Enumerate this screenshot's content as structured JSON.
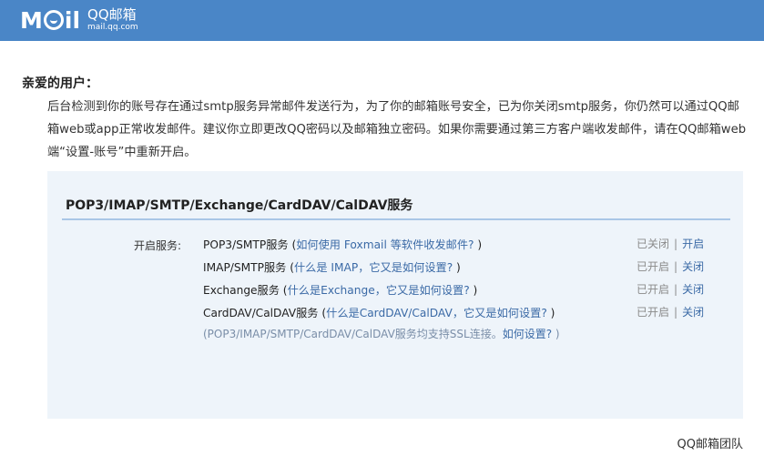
{
  "header": {
    "logo_word_left": "M",
    "logo_word_right": "il",
    "brand": "QQ邮箱",
    "domain": "mail.qq.com",
    "bar_color": "#4a86c7"
  },
  "greeting": "亲爱的用户：",
  "message": "后台检测到你的账号存在通过smtp服务异常邮件发送行为，为了你的邮箱账号安全，已为你关闭smtp服务，你仍然可以通过QQ邮箱web或app正常收发邮件。建议你立即更改QQ密码以及邮箱独立密码。如果你需要通过第三方客户端收发邮件，请在QQ邮箱web端“设置-账号”中重新开启。",
  "panel": {
    "title": "POP3/IMAP/SMTP/Exchange/CardDAV/CalDAV服务",
    "services_label": "开启服务:",
    "services": [
      {
        "name": "POP3/SMTP服务",
        "open_paren": " (",
        "help": "如何使用 Foxmail 等软件收发邮件?",
        "close_paren": " )",
        "status": "已关闭",
        "divider": "|",
        "action": "开启"
      },
      {
        "name": "IMAP/SMTP服务",
        "open_paren": " (",
        "help": "什么是 IMAP，它又是如何设置?",
        "close_paren": " )",
        "status": "已开启",
        "divider": "|",
        "action": "关闭"
      },
      {
        "name": "Exchange服务",
        "open_paren": " (",
        "help": "什么是Exchange，它又是如何设置?",
        "close_paren": " )",
        "status": "已开启",
        "divider": "|",
        "action": "关闭"
      },
      {
        "name": "CardDAV/CalDAV服务",
        "open_paren": " (",
        "help": "什么是CardDAV/CalDAV，它又是如何设置?",
        "close_paren": " )",
        "status": "已开启",
        "divider": "|",
        "action": "关闭"
      }
    ],
    "note_text": "(POP3/IMAP/SMTP/CardDAV/CalDAV服务均支持SSL连接。",
    "note_link": "如何设置?",
    "note_close": " )",
    "background": "#eef4fa",
    "link_color": "#3b6aa6"
  },
  "signature": "QQ邮箱团队"
}
